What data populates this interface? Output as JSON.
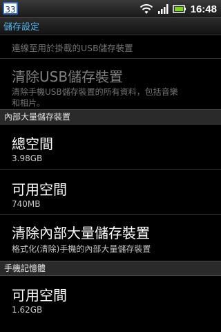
{
  "status_bar": {
    "notification_count": "33",
    "time": "16:48",
    "icons": [
      "wifi-icon",
      "signal-icon",
      "battery-icon"
    ],
    "accent_color": "#2b6fd6"
  },
  "title_bar": {
    "title": "儲存設定"
  },
  "items": {
    "unmount_usb": {
      "summary": "連線至用於掛載的USB儲存裝置"
    },
    "erase_usb": {
      "title": "清除USB儲存裝置",
      "summary_line1": "清除手機USB儲存裝置的所有資料，包括音樂",
      "summary_line2": "和相片。"
    },
    "internal_header": {
      "title": "內部大量儲存裝置"
    },
    "total_space": {
      "title": "總空間",
      "value": "3.98GB"
    },
    "available_space": {
      "title": "可用空間",
      "value": "740MB"
    },
    "erase_internal": {
      "title": "清除內部大量儲存裝置",
      "summary": "格式化(清除)手機的內部大量儲存裝置"
    },
    "phone_memory_header": {
      "title": "手機記憶體"
    },
    "phone_available_space": {
      "title": "可用空間",
      "value": "1.62GB"
    }
  }
}
